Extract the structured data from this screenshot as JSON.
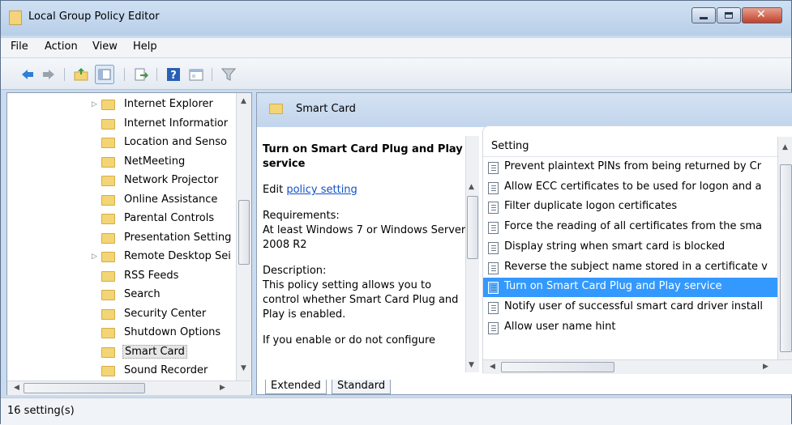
{
  "window": {
    "title": "Local Group Policy Editor"
  },
  "menu": [
    "File",
    "Action",
    "View",
    "Help"
  ],
  "tree": {
    "items": [
      {
        "label": "Internet Explorer",
        "expandable": true
      },
      {
        "label": "Internet Informatior",
        "expandable": false
      },
      {
        "label": "Location and Senso",
        "expandable": false
      },
      {
        "label": "NetMeeting",
        "expandable": false
      },
      {
        "label": "Network Projector",
        "expandable": false
      },
      {
        "label": "Online Assistance",
        "expandable": false
      },
      {
        "label": "Parental Controls",
        "expandable": false
      },
      {
        "label": "Presentation Setting",
        "expandable": false
      },
      {
        "label": "Remote Desktop Sei",
        "expandable": true
      },
      {
        "label": "RSS Feeds",
        "expandable": false
      },
      {
        "label": "Search",
        "expandable": false
      },
      {
        "label": "Security Center",
        "expandable": false
      },
      {
        "label": "Shutdown Options",
        "expandable": false
      },
      {
        "label": "Smart Card",
        "expandable": false,
        "selected": true
      },
      {
        "label": "Sound Recorder",
        "expandable": false
      }
    ]
  },
  "right": {
    "header_title": "Smart Card",
    "extended": {
      "policy_title": "Turn on Smart Card Plug and Play service",
      "edit_prefix": "Edit",
      "edit_link": "policy setting",
      "requirements_label": "Requirements:",
      "requirements_text": "At least Windows 7 or Windows Server 2008 R2",
      "description_label": "Description:",
      "description_text": "This policy setting allows you to control whether Smart Card Plug and Play is enabled.",
      "more_text": "If you enable or do not configure"
    },
    "list": {
      "column_header": "Setting",
      "rows": [
        {
          "label": "Prevent plaintext PINs from being returned by Cr"
        },
        {
          "label": "Allow ECC certificates to be used for logon and a"
        },
        {
          "label": "Filter duplicate logon certificates"
        },
        {
          "label": "Force the reading of all certificates from the sma"
        },
        {
          "label": "Display string when smart card is blocked"
        },
        {
          "label": "Reverse the subject name stored in a certificate v"
        },
        {
          "label": "Turn on Smart Card Plug and Play service",
          "selected": true
        },
        {
          "label": "Notify user of successful smart card driver install"
        },
        {
          "label": "Allow user name hint"
        }
      ]
    },
    "tabs": [
      "Extended",
      "Standard"
    ]
  },
  "status": {
    "text": "16 setting(s)"
  },
  "toolbar_icons": [
    "back-arrow-icon",
    "forward-arrow-icon",
    "up-folder-icon",
    "show-hide-tree-icon",
    "export-list-icon",
    "help-icon",
    "properties-icon",
    "filter-icon"
  ]
}
